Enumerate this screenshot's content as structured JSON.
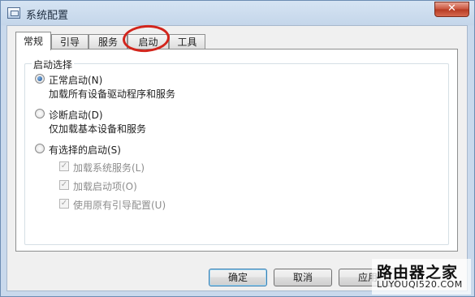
{
  "window": {
    "title": "系统配置",
    "close_label": "✕"
  },
  "tabs": [
    {
      "label": "常规",
      "active": true
    },
    {
      "label": "引导",
      "active": false
    },
    {
      "label": "服务",
      "active": false
    },
    {
      "label": "启动",
      "active": false,
      "highlighted": true
    },
    {
      "label": "工具",
      "active": false
    }
  ],
  "startup_group": {
    "title": "启动选择",
    "options": [
      {
        "label": "正常启动(N)",
        "description": "加载所有设备驱动程序和服务",
        "checked": true
      },
      {
        "label": "诊断启动(D)",
        "description": "仅加载基本设备和服务",
        "checked": false
      },
      {
        "label": "有选择的启动(S)",
        "description": "",
        "checked": false
      }
    ],
    "selective_items": [
      {
        "label": "加载系统服务(L)",
        "checked": true,
        "enabled": false
      },
      {
        "label": "加载启动项(O)",
        "checked": true,
        "enabled": false
      },
      {
        "label": "使用原有引导配置(U)",
        "checked": true,
        "enabled": false
      }
    ]
  },
  "buttons": {
    "ok": "确定",
    "cancel": "取消",
    "apply": "应用"
  },
  "watermark": {
    "main": "路由器之家",
    "sub": "LUYOUQI520.COM"
  },
  "colors": {
    "highlight": "#d2251c",
    "titlebar": "#c4d6ea",
    "close_button": "#c9523a"
  }
}
